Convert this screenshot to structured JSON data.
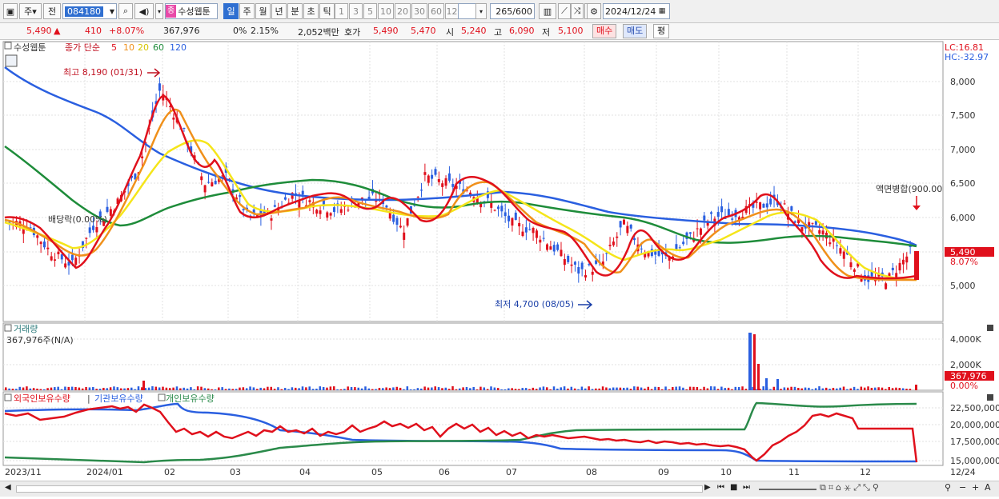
{
  "toolbar": {
    "market": "주",
    "prev_label": "전",
    "stock_code": "084180",
    "category_badge": "종",
    "stock_name": "수성웹툰",
    "periods": [
      "일",
      "주",
      "월",
      "년",
      "분",
      "초",
      "틱"
    ],
    "active_period": "일",
    "intervals": [
      "1",
      "3",
      "5",
      "10",
      "20",
      "30",
      "60",
      "120"
    ],
    "count": "265",
    "count_total": "/600",
    "date": "2024/12/24"
  },
  "quote": {
    "price": "5,490",
    "arrow": "▲",
    "change": "410",
    "change_pct": "+8.07%",
    "volume": "367,976",
    "zero_pct": "0%",
    "turnover_pct": "2.15%",
    "amount": "2,052백만",
    "bid_label": "호가",
    "ask": "5,490",
    "bid": "5,470",
    "open_label": "시",
    "open": "5,240",
    "high_label": "고",
    "high": "6,090",
    "low_label": "저",
    "low": "5,100",
    "buy_label": "매수",
    "sell_label": "매도",
    "avg_label": "평"
  },
  "price_panel": {
    "title": "수성웹툰",
    "ma_label": "종가 단순",
    "ma_periods": [
      "5",
      "10",
      "20",
      "60",
      "120"
    ],
    "ma_colors": [
      "#e0101c",
      "#f0901a",
      "#f5e51a",
      "#1e8c3a",
      "#2a5fe0"
    ],
    "lc": "LC:16.81",
    "hc": "HC:-32.97",
    "y_ticks": [
      "8,000",
      "7,500",
      "7,000",
      "6,500",
      "6,000",
      "5,500",
      "5,000"
    ],
    "high_note": "최고 8,190 (01/31)",
    "low_note": "최저 4,700 (08/05)",
    "dividend_note": "배당락(0.00%)",
    "merge_note": "액면병합(900.00",
    "current_price_tag": "5,490",
    "current_pct_tag": "8.07%"
  },
  "volume_panel": {
    "title": "거래량",
    "subtitle": "367,976주(N/A)",
    "y_ticks": [
      "4,000K",
      "2,000K"
    ],
    "current_tag": "367,976",
    "pct_tag": "0.00%"
  },
  "holdings_panel": {
    "series": [
      "외국인보유수량",
      "기관보유수량",
      "개인보유수량"
    ],
    "series_colors": [
      "#e0101c",
      "#2a5fe0",
      "#2a8a4a"
    ],
    "y_ticks": [
      "22,500,000",
      "20,000,000",
      "17,500,000",
      "15,000,000"
    ]
  },
  "x_axis": [
    "2023/11",
    "2024/01",
    "02",
    "03",
    "04",
    "05",
    "06",
    "07",
    "08",
    "09",
    "10",
    "11",
    "12",
    "12/24"
  ],
  "chart_data": [
    {
      "type": "candlestick",
      "title": "수성웹툰",
      "ylim": [
        4700,
        8190
      ],
      "x_dates": [
        "2023/11",
        "2024/01",
        "02",
        "03",
        "04",
        "05",
        "06",
        "07",
        "08",
        "09",
        "10",
        "11",
        "12",
        "12/24"
      ],
      "close_path": [
        5950,
        5900,
        5500,
        5300,
        5900,
        6200,
        6700,
        7900,
        7300,
        6500,
        6600,
        6000,
        6050,
        6350,
        6200,
        6100,
        6250,
        6300,
        5800,
        6600,
        6500,
        6400,
        6200,
        5900,
        5800,
        5500,
        5200,
        5300,
        5900,
        5500,
        5400,
        5700,
        6000,
        6050,
        6150,
        6250,
        5900,
        5800,
        5500,
        5100,
        5100,
        5490
      ],
      "ma120_path": [
        7200,
        6900,
        6550,
        6300,
        6200,
        6050,
        6000,
        5980,
        5950,
        5900,
        5850,
        5850,
        5800,
        5750,
        5600
      ],
      "ma60_path": [
        7000,
        6400,
        6000,
        6050,
        6400,
        6500,
        6300,
        6150,
        6200,
        6100,
        6000,
        5850,
        5700,
        5650,
        5600
      ],
      "markers": {
        "high": 8190,
        "high_date": "01/31",
        "low": 4700,
        "low_date": "08/05"
      }
    },
    {
      "type": "bar",
      "title": "거래량",
      "ylim": [
        0,
        4000000
      ],
      "notable_spikes": [
        {
          "x": "10",
          "value": 4500000
        },
        {
          "x": "10",
          "value": 3500000
        }
      ],
      "last": 367976
    },
    {
      "type": "line",
      "ylim": [
        15000000,
        22500000
      ],
      "series": [
        {
          "name": "외국인보유수량",
          "values": [
            21800000,
            21500000,
            22800000,
            22000000,
            19500000,
            18800000,
            18500000,
            19500000,
            18500000,
            17800000,
            17500000,
            15000000,
            21500000,
            22000000,
            19500000,
            19500000,
            15000000
          ]
        },
        {
          "name": "기관보유수량",
          "values": [
            22500000,
            22500000,
            23500000,
            22300000,
            21000000,
            19000000,
            18000000,
            18000000,
            17500000,
            16500000,
            16000000,
            15000000,
            15000000,
            15000000,
            15000000,
            15000000,
            15000000
          ]
        },
        {
          "name": "개인보유수량",
          "values": [
            15500000,
            15200000,
            14900000,
            15500000,
            16500000,
            17500000,
            17800000,
            18000000,
            19000000,
            19000000,
            19000000,
            23000000,
            22800000,
            23000000,
            23500000,
            23500000,
            23500000
          ]
        }
      ]
    }
  ]
}
